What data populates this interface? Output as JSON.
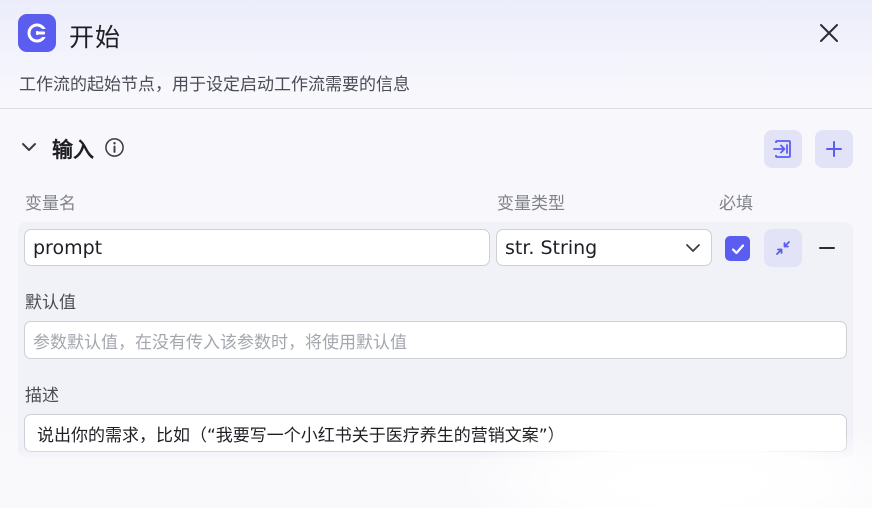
{
  "header": {
    "title": "开始",
    "subtitle": "工作流的起始节点，用于设定启动工作流需要的信息",
    "accent": "#5b5cf0"
  },
  "inputs_section": {
    "title": "输入",
    "columns": {
      "name": "变量名",
      "type": "变量类型",
      "required": "必填"
    },
    "variable": {
      "name": "prompt",
      "type": "str. String",
      "required": true,
      "default_label": "默认值",
      "default_placeholder": "参数默认值，在没有传入该参数时，将使用默认值",
      "description_label": "描述",
      "description_value": "说出你的需求，比如（“我要写一个小红书关于医疗养生的营销文案”）"
    }
  },
  "icons": {
    "app": "workflow-start-icon",
    "close": "close-icon",
    "toggle": "chevron-down-icon",
    "info": "info-icon",
    "import": "import-icon",
    "add": "plus-icon",
    "collapse": "collapse-arrows-icon",
    "remove": "minus-icon",
    "check": "check-icon",
    "select": "chevron-down-icon"
  }
}
